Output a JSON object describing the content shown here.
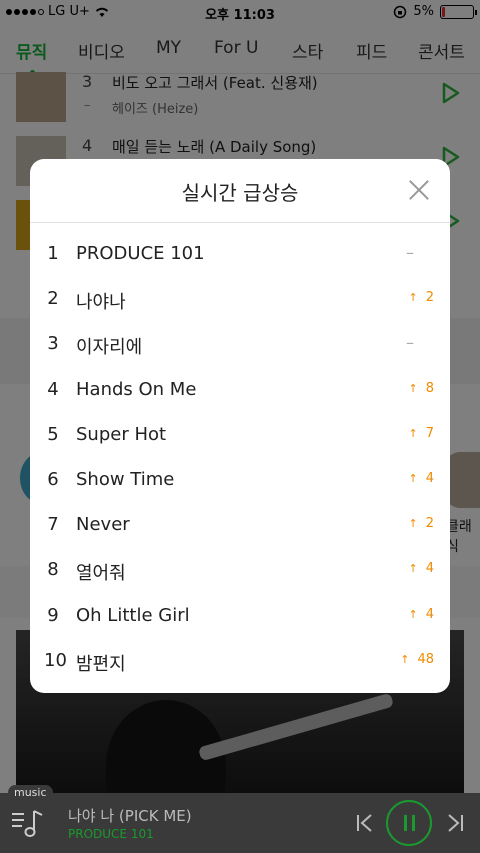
{
  "status_bar": {
    "carrier": "LG U+",
    "time": "오후 11:03",
    "battery_percent": "5%",
    "battery_level": 0.05,
    "battery_color": "#e33"
  },
  "tabs": [
    {
      "label": "뮤직",
      "active": true
    },
    {
      "label": "비디오",
      "active": false
    },
    {
      "label": "MY",
      "active": false
    },
    {
      "label": "For U",
      "active": false
    },
    {
      "label": "스타",
      "active": false
    },
    {
      "label": "피드",
      "active": false
    },
    {
      "label": "콘서트",
      "active": false
    }
  ],
  "background_list": [
    {
      "rank": "3",
      "title": "비도 오고 그래서 (Feat. 신용재)",
      "artist": "헤이즈 (Heize)",
      "change": "–"
    },
    {
      "rank": "4",
      "title": "매일 듣는 노래 (A Daily Song)",
      "artist": "",
      "change": ""
    }
  ],
  "background_side_text": "클래식",
  "modal": {
    "title": "실시간 급상승",
    "items": [
      {
        "rank": "1",
        "title": "PRODUCE 101",
        "change": "–",
        "direction": "none"
      },
      {
        "rank": "2",
        "title": "나야나",
        "change": "2",
        "direction": "up"
      },
      {
        "rank": "3",
        "title": "이자리에",
        "change": "–",
        "direction": "none"
      },
      {
        "rank": "4",
        "title": "Hands On Me",
        "change": "8",
        "direction": "up"
      },
      {
        "rank": "5",
        "title": "Super Hot",
        "change": "7",
        "direction": "up"
      },
      {
        "rank": "6",
        "title": "Show Time",
        "change": "4",
        "direction": "up"
      },
      {
        "rank": "7",
        "title": "Never",
        "change": "2",
        "direction": "up"
      },
      {
        "rank": "8",
        "title": "열어줘",
        "change": "4",
        "direction": "up"
      },
      {
        "rank": "9",
        "title": "Oh Little Girl",
        "change": "4",
        "direction": "up"
      },
      {
        "rank": "10",
        "title": "밤편지",
        "change": "48",
        "direction": "up"
      }
    ]
  },
  "player": {
    "tag": "music",
    "title": "나야 나 (PICK ME)",
    "artist": "PRODUCE 101",
    "accent_color": "#1a9a2e"
  },
  "icons": [
    "wifi-icon",
    "lock-rotation-icon",
    "close-icon",
    "play-icon",
    "arrow-up-icon",
    "playlist-icon",
    "previous-icon",
    "pause-icon",
    "next-icon"
  ]
}
